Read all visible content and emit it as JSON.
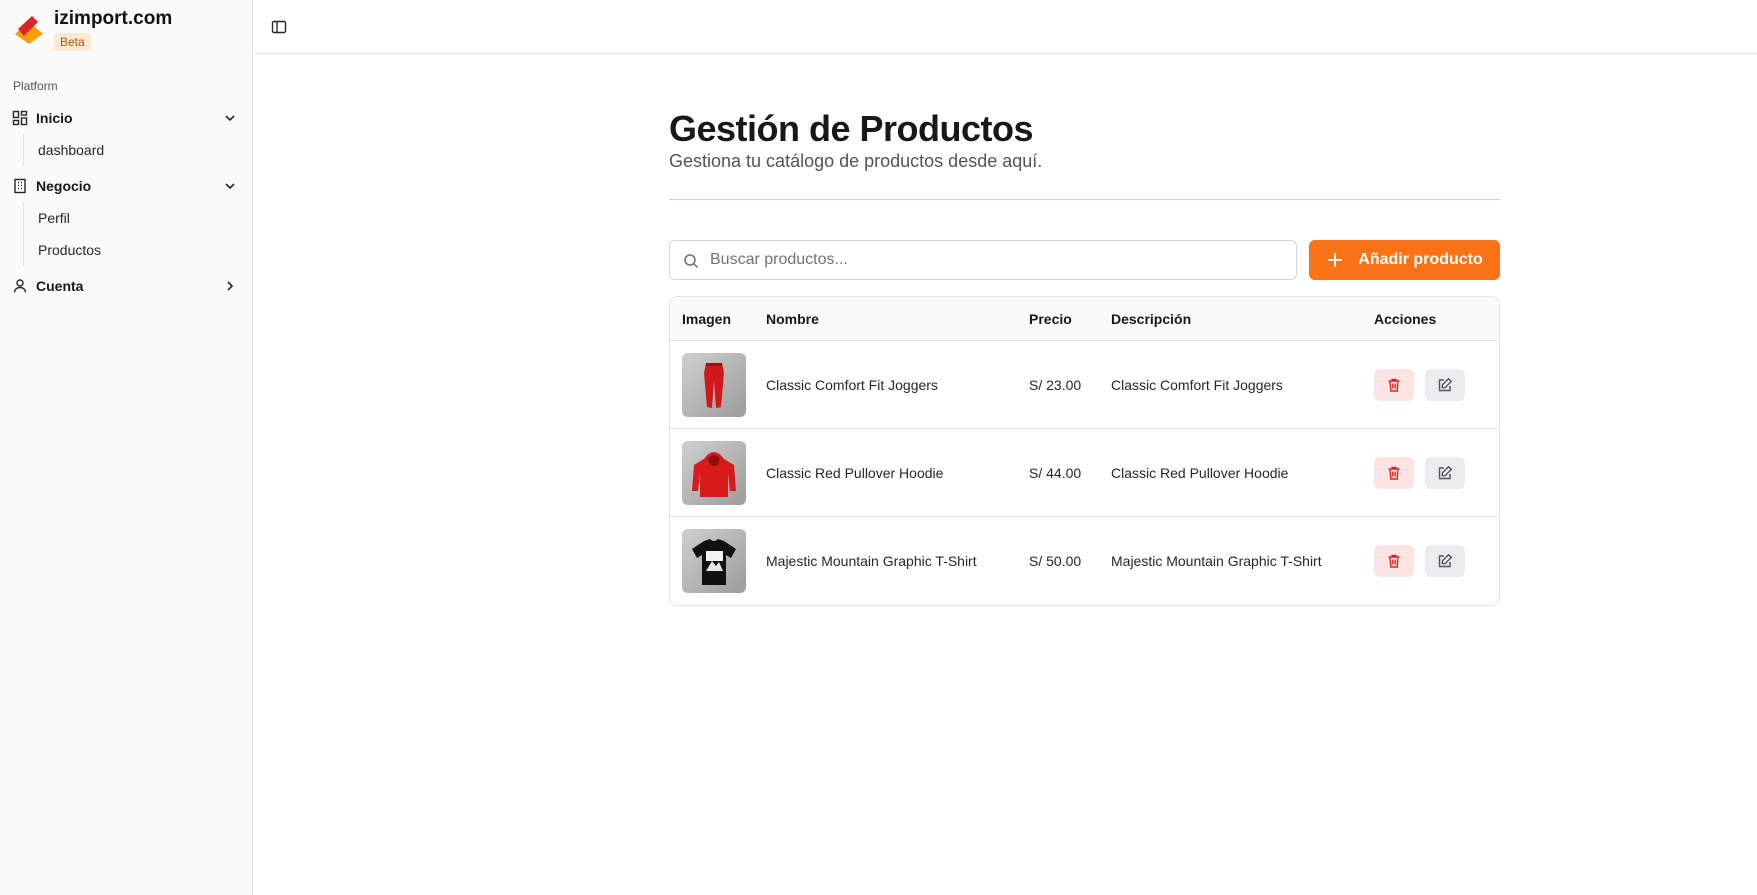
{
  "brand": {
    "name": "izimport.com",
    "badge": "Beta"
  },
  "sidebar": {
    "section_label": "Platform",
    "groups": [
      {
        "label": "Inicio",
        "icon": "layout-dashboard-icon",
        "expanded": true,
        "items": [
          {
            "label": "dashboard"
          }
        ]
      },
      {
        "label": "Negocio",
        "icon": "building-icon",
        "expanded": true,
        "items": [
          {
            "label": "Perfil"
          },
          {
            "label": "Productos"
          }
        ]
      },
      {
        "label": "Cuenta",
        "icon": "user-icon",
        "expanded": false,
        "items": []
      }
    ]
  },
  "topbar": {
    "toggle_icon": "sidebar-toggle-icon"
  },
  "main": {
    "title": "Gestión de Productos",
    "subtitle": "Gestiona tu catálogo de productos desde aquí.",
    "search": {
      "placeholder": "Buscar productos...",
      "value": ""
    },
    "add_button": "Añadir producto"
  },
  "table": {
    "headers": {
      "image": "Imagen",
      "name": "Nombre",
      "price": "Precio",
      "description": "Descripción",
      "actions": "Acciones"
    },
    "rows": [
      {
        "image": "red-joggers",
        "name": "Classic Comfort Fit Joggers",
        "price": "S/ 23.00",
        "description": "Classic Comfort Fit Joggers"
      },
      {
        "image": "red-hoodie",
        "name": "Classic Red Pullover Hoodie",
        "price": "S/ 44.00",
        "description": "Classic Red Pullover Hoodie"
      },
      {
        "image": "black-mountain-tshirt",
        "name": "Majestic Mountain Graphic T-Shirt",
        "price": "S/ 50.00",
        "description": "Majestic Mountain Graphic T-Shirt"
      }
    ]
  },
  "colors": {
    "accent": "#f97316",
    "danger": "#dc2626",
    "danger_bg": "#fde4e4",
    "sidebar_bg": "#fafafa"
  }
}
